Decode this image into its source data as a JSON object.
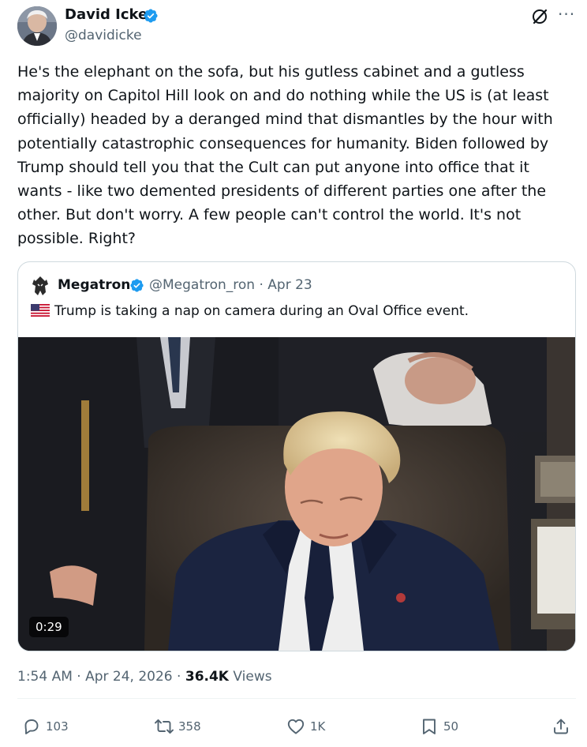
{
  "author": {
    "name": "David Icke",
    "handle": "@davidicke"
  },
  "tweet": {
    "text_lines": [
      "He's the elephant on the sofa, but his gutless cabinet and a gutless",
      "majority on Capitol Hill look on and do nothing while the US is (at least",
      "officially) headed by a deranged mind that dismantles by the hour with",
      "potentially catastrophic consequences for humanity. Biden followed by",
      "Trump should tell you that the Cult can put anyone into office that it",
      "wants - like two demented presidents of different parties one after the",
      "other.  But don't worry. A few people can't control the world. It's not",
      "possible. Right?"
    ]
  },
  "quote": {
    "name": "Megatron",
    "handle": "@Megatron_ron",
    "date": "Apr 23",
    "meta": "@Megatron_ron · Apr 23",
    "text": "Trump is taking a nap on camera during an Oval Office event.",
    "video_duration": "0:29"
  },
  "meta": {
    "time": "1:54 AM",
    "date": "Apr 24, 2026",
    "views_count": "36.4K",
    "views_label": "Views"
  },
  "actions": {
    "replies": "103",
    "reposts": "358",
    "likes": "1K",
    "bookmarks": "50"
  },
  "icons": {
    "verified": "verified-badge-icon",
    "grok": "grok-icon",
    "more": "more-icon",
    "reply": "reply-icon",
    "repost": "repost-icon",
    "like": "heart-icon",
    "bookmark": "bookmark-icon",
    "share": "share-icon",
    "flag": "us-flag-icon"
  },
  "colors": {
    "verified_blue": "#1d9bf0",
    "secondary_text": "#536471",
    "primary_text": "#0f1419",
    "border": "#cfd9de"
  }
}
